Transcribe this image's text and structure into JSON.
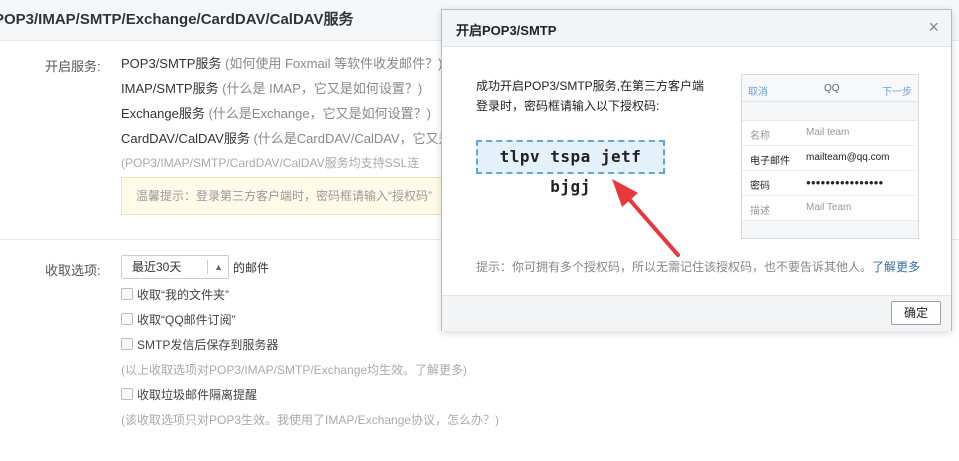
{
  "header": {
    "title": "POP3/IMAP/SMTP/Exchange/CardDAV/CalDAV服务"
  },
  "services": {
    "label": "开启服务:",
    "items": [
      {
        "name": "POP3/SMTP服务",
        "hint": "(如何使用 Foxmail 等软件收发邮件？)"
      },
      {
        "name": "IMAP/SMTP服务",
        "hint": "(什么是 IMAP，它又是如何设置？)"
      },
      {
        "name": "Exchange服务",
        "hint": "(什么是Exchange，它又是如何设置？)"
      },
      {
        "name": "CardDAV/CalDAV服务",
        "hint": "(什么是CardDAV/CalDAV，它又是"
      }
    ],
    "ssl_note": "(POP3/IMAP/SMTP/CardDAV/CalDAV服务均支持SSL连",
    "tip": "温馨提示：登录第三方客户端时，密码框请输入“授权码”"
  },
  "receive": {
    "label": "收取选项:",
    "select_value": "最近30天",
    "select_suffix": "的邮件",
    "options": [
      {
        "label": "收取“我的文件夹”"
      },
      {
        "label": "收取“QQ邮件订阅”"
      },
      {
        "label": "SMTP发信后保存到服务器"
      }
    ],
    "note1": "(以上收取选项对POP3/IMAP/SMTP/Exchange均生效。了解更多)",
    "spam_label": "收取垃圾邮件隔离提醒",
    "note2": "(该收取选项只对POP3生效。我使用了IMAP/Exchange协议，怎么办？)"
  },
  "modal": {
    "title": "开启POP3/SMTP",
    "close": "×",
    "desc": "成功开启POP3/SMTP服务,在第三方客户端登录时，密码框请输入以下授权码:",
    "auth_code": "tlpv tspa jetf bjgj",
    "tip": "提示：你可拥有多个授权码，所以无需记住该授权码，也不要告诉其他人。",
    "tip_link": "了解更多",
    "ok": "确定",
    "phone": {
      "cancel": "取消",
      "title": "QQ",
      "next": "下一步",
      "rows": [
        {
          "k": "名称",
          "v": "Mail team"
        },
        {
          "k": "电子邮件",
          "v": "mailteam@qq.com"
        },
        {
          "k": "密码",
          "v": "●●●●●●●●●●●●●●●●"
        },
        {
          "k": "描述",
          "v": "Mail Team"
        }
      ]
    }
  },
  "colors": {
    "arrow": "#e8383d",
    "code_border": "#5fa8d6",
    "code_bg": "#e5f1fa"
  }
}
